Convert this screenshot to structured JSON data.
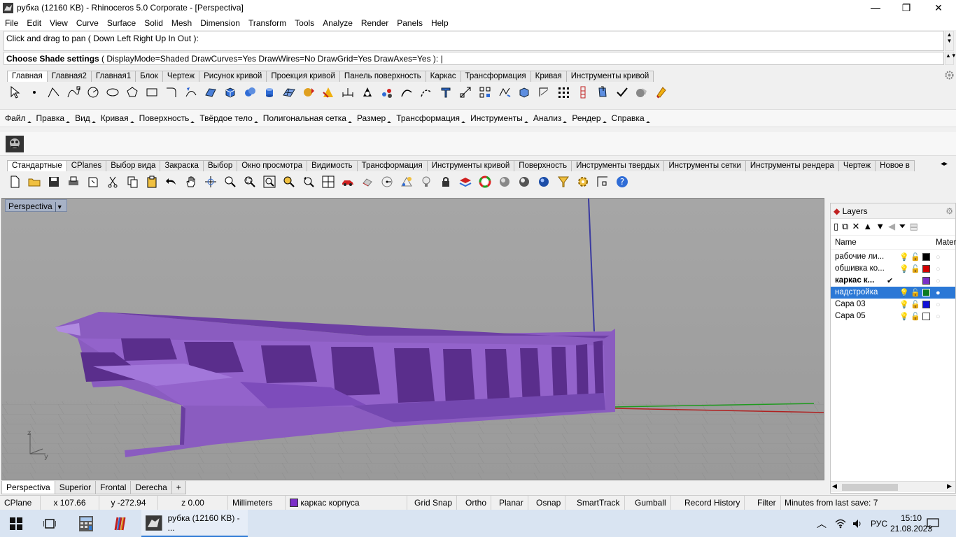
{
  "window": {
    "title": "рубка (12160 KB) - Rhinoceros  5.0 Corporate - [Perspectiva]",
    "minimize": "—",
    "restore": "❐",
    "close": "✕"
  },
  "menu": [
    "File",
    "Edit",
    "View",
    "Curve",
    "Surface",
    "Solid",
    "Mesh",
    "Dimension",
    "Transform",
    "Tools",
    "Analyze",
    "Render",
    "Panels",
    "Help"
  ],
  "command": {
    "history": "Click and drag to pan ( Down  Left  Right  Up  In  Out ):",
    "prompt_bold": "Choose Shade settings",
    "prompt_rest": " ( DisplayMode=Shaded  DrawCurves=Yes  DrawWires=No  DrawGrid=Yes  DrawAxes=Yes ): "
  },
  "tabs1": [
    "Главная",
    "Главная2",
    "Главная1",
    "Блок",
    "Чертеж",
    "Рисунок кривой",
    "Проекция кривой",
    "Панель поверхность",
    "Каркас",
    "Трансформация",
    "Кривая",
    "Инструменты кривой"
  ],
  "rumenu": [
    "Файл",
    "Правка",
    "Вид",
    "Кривая",
    "Поверхность",
    "Твёрдое тело",
    "Полигональная сетка",
    "Размер",
    "Трансформация",
    "Инструменты",
    "Анализ",
    "Рендер",
    "Справка"
  ],
  "tabs2": [
    "Стандартные",
    "CPlanes",
    "Выбор вида",
    "Закраска",
    "Выбор",
    "Окно просмотра",
    "Видимость",
    "Трансформация",
    "Инструменты кривой",
    "Поверхность",
    "Инструменты твердых",
    "Инструменты сетки",
    "Инструменты рендера",
    "Чертеж",
    "Новое в"
  ],
  "viewport": {
    "label": "Perspectiva",
    "axis_z": "z",
    "axis_y": "y"
  },
  "viewport_tabs": [
    "Perspectiva",
    "Superior",
    "Frontal",
    "Derecha"
  ],
  "layers": {
    "title": "Layers",
    "col_name": "Name",
    "col_material": "Mater",
    "rows": [
      {
        "name": "рабочие ли...",
        "color": "#000000",
        "bold": false,
        "selected": false
      },
      {
        "name": "обшивка ко...",
        "color": "#d40000",
        "bold": false,
        "selected": false
      },
      {
        "name": "каркас к...",
        "color": "#7b2fc8",
        "bold": true,
        "selected": false,
        "current": "✔"
      },
      {
        "name": "надстройка",
        "color": "#0a7a22",
        "bold": false,
        "selected": true
      },
      {
        "name": "Сара 03",
        "color": "#1010d8",
        "bold": false,
        "selected": false
      },
      {
        "name": "Сара 05",
        "color": "#ffffff",
        "bold": false,
        "selected": false
      }
    ]
  },
  "status": {
    "cplane": "CPlane",
    "x": "x 107.66",
    "y": "y -272.94",
    "z": "z 0.00",
    "units": "Millimeters",
    "layer": "каркас корпуса",
    "layer_color": "#7b2fc8",
    "grid_snap": "Grid Snap",
    "ortho": "Ortho",
    "planar": "Planar",
    "osnap": "Osnap",
    "smarttrack": "SmartTrack",
    "gumball": "Gumball",
    "record_history": "Record History",
    "filter": "Filter",
    "minutes": "Minutes from last save: 7"
  },
  "taskbar": {
    "app": "рубка (12160 KB) - ...",
    "lang": "РУС",
    "time": "15:10",
    "date": "21.08.2023"
  }
}
